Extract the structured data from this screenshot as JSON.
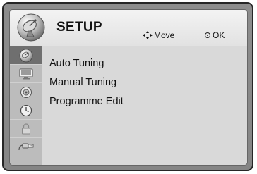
{
  "header": {
    "title": "SETUP",
    "move_label": "Move",
    "ok_label": "OK",
    "icon": "satellite-dish-icon"
  },
  "sidebar": {
    "items": [
      {
        "icon": "satellite-dish-icon",
        "active": true
      },
      {
        "icon": "monitor-icon",
        "active": false
      },
      {
        "icon": "speaker-icon",
        "active": false
      },
      {
        "icon": "clock-icon",
        "active": false
      },
      {
        "icon": "padlock-icon",
        "active": false
      },
      {
        "icon": "usb-icon",
        "active": false
      }
    ]
  },
  "menu": {
    "items": [
      {
        "label": "Auto Tuning"
      },
      {
        "label": "Manual Tuning"
      },
      {
        "label": "Programme Edit"
      }
    ]
  }
}
